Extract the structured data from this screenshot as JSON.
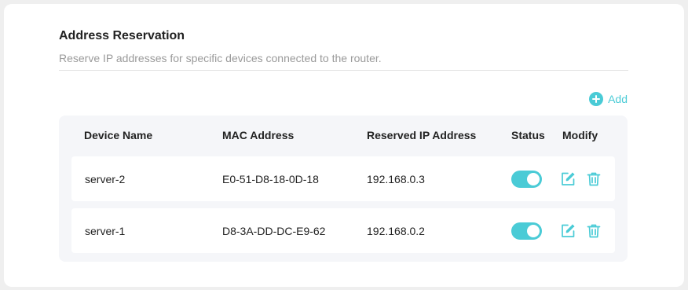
{
  "section": {
    "title": "Address Reservation",
    "subtitle": "Reserve IP addresses for specific devices connected to the router."
  },
  "actions": {
    "add_label": "Add",
    "add_icon": "plus-circle-icon"
  },
  "table": {
    "columns": [
      "Device Name",
      "MAC Address",
      "Reserved IP Address",
      "Status",
      "Modify"
    ],
    "rows": [
      {
        "device_name": "server-2",
        "mac_address": "E0-51-D8-18-0D-18",
        "reserved_ip": "192.168.0.3",
        "status_enabled": true
      },
      {
        "device_name": "server-1",
        "mac_address": "D8-3A-DD-DC-E9-62",
        "reserved_ip": "192.168.0.2",
        "status_enabled": true
      }
    ]
  },
  "colors": {
    "accent": "#4acbd6",
    "page_bg": "#efefef",
    "table_bg": "#f5f6f9"
  },
  "icons": {
    "edit": "edit-icon",
    "delete": "trash-icon"
  }
}
